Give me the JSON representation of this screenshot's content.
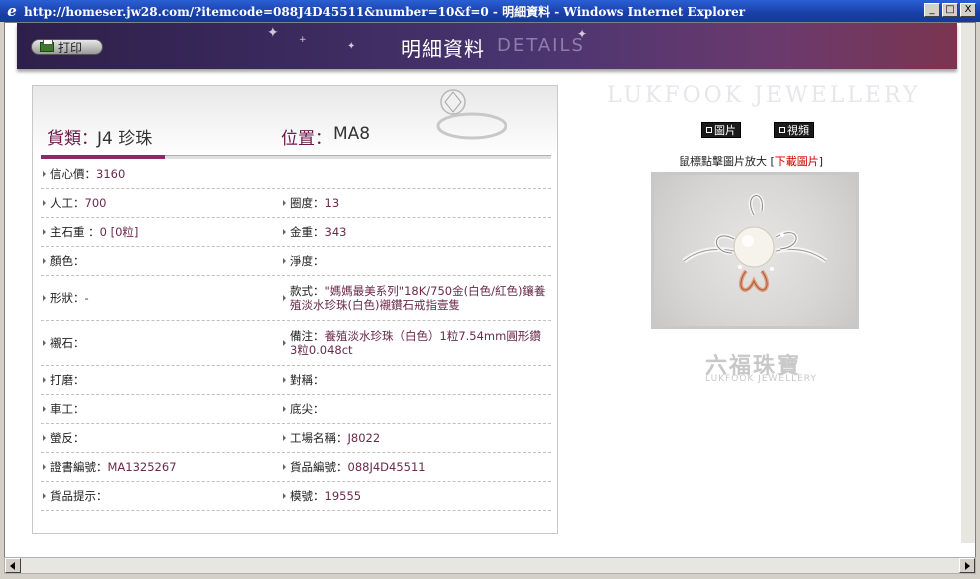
{
  "window": {
    "title": "http://homeser.jw28.com/?itemcode=088J4D45511&number=10&f=0 - 明細資料 - Windows Internet Explorer",
    "minimize": "_",
    "maximize": "□",
    "close": "X"
  },
  "banner": {
    "print_label": "打印",
    "title": "明細資料",
    "subtitle": "DETAILS"
  },
  "header": {
    "kind_label": "貨類：",
    "kind_value": "J4 珍珠",
    "location_label": "位置：",
    "location_value": "MA8"
  },
  "rows": [
    {
      "left": {
        "label": "信心價：",
        "value": "3160"
      }
    },
    {
      "left": {
        "label": "人工：",
        "value": "700"
      },
      "right": {
        "label": "圈度：",
        "value": "13"
      }
    },
    {
      "left": {
        "label": "主石重 ：",
        "value": "0 [0粒]"
      },
      "right": {
        "label": "金重：",
        "value": "343"
      }
    },
    {
      "left": {
        "label": "顏色：",
        "value": ""
      },
      "right": {
        "label": "淨度：",
        "value": ""
      }
    },
    {
      "left": {
        "label": "形狀：",
        "value": "-"
      },
      "right": {
        "label": "款式：",
        "value": "\"媽媽最美系列\"18K/750金(白色/紅色)鑲養殖淡水珍珠(白色)襯鑽石戒指壹隻"
      }
    },
    {
      "left": {
        "label": "襯石：",
        "value": ""
      },
      "right": {
        "label": "備注：",
        "value": "養殖淡水珍珠（白色）1粒7.54mm圓形鑽3粒0.048ct"
      }
    },
    {
      "left": {
        "label": "打磨：",
        "value": ""
      },
      "right": {
        "label": "對稱：",
        "value": ""
      }
    },
    {
      "left": {
        "label": "車工：",
        "value": ""
      },
      "right": {
        "label": "底尖：",
        "value": ""
      }
    },
    {
      "left": {
        "label": "螢反：",
        "value": ""
      },
      "right": {
        "label": "工場名稱：",
        "value": "J8022"
      }
    },
    {
      "left": {
        "label": "證書編號：",
        "value": "MA1325267"
      },
      "right": {
        "label": "貨品編號：",
        "value": "088J4D45511"
      }
    },
    {
      "left": {
        "label": "貨品提示：",
        "value": ""
      },
      "right": {
        "label": "模號：",
        "value": "19555"
      }
    }
  ],
  "side": {
    "brand_text": "LUKFOOK JEWELLERY",
    "picture_button": "圖片",
    "video_button": "視頻",
    "hint_text": "鼠標點擊圖片放大",
    "hint_open": "[",
    "download_link": "下載圖片",
    "hint_close": "]",
    "logo_cn": "六福珠寶",
    "logo_en": "LUKFOOK JEWELLERY"
  },
  "colors": {
    "banner": "#3b2a5e",
    "accent": "#8a2a6a",
    "download_link": "#cc0000"
  }
}
